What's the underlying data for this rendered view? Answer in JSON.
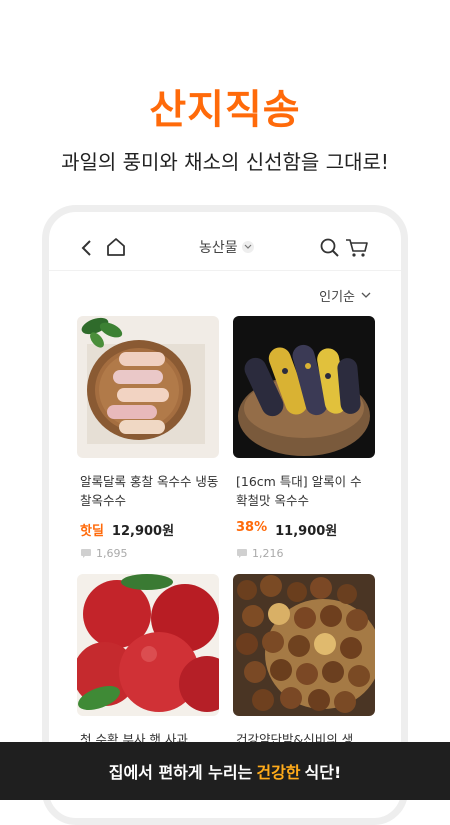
{
  "hero": {
    "title": "산지직송",
    "subtitle": "과일의 풍미와 채소의 신선함을 그대로!"
  },
  "topbar": {
    "back_icon": "chevron-left-icon",
    "home_icon": "home-icon",
    "category_label": "농산물",
    "search_icon": "search-icon",
    "cart_icon": "cart-icon"
  },
  "sort": {
    "label": "인기순"
  },
  "products": [
    {
      "title": "알록달록 홍찰 옥수수 냉동 찰옥수수",
      "badge": "핫딜",
      "price": "12,900원",
      "reviews": "1,695"
    },
    {
      "title": "[16cm 특대] 알록이 수 확철맛 옥수수",
      "badge": "38%",
      "price": "11,900원",
      "reviews": "1,216"
    },
    {
      "title": "첫 수확 부사 햇 사과",
      "badge": "",
      "price": "",
      "reviews": ""
    },
    {
      "title": "건강약단밤&신비의 생",
      "badge": "",
      "price": "",
      "reviews": ""
    }
  ],
  "banner": {
    "prefix": "집에서 편하게 누리는",
    "accent": "건강한",
    "suffix": "식단!"
  },
  "colors": {
    "accent": "#ff6a0a",
    "banner_bg": "#1f1f1f",
    "banner_accent": "#ffab1a"
  }
}
